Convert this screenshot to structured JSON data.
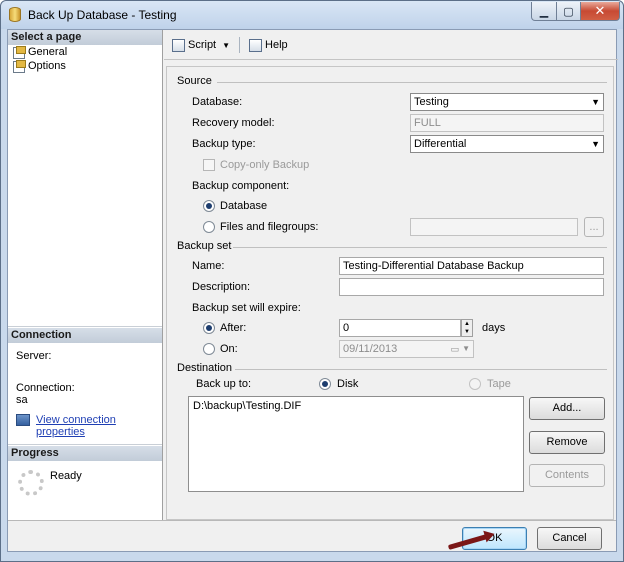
{
  "window": {
    "title": "Back Up Database - Testing",
    "controls": {
      "minimize": "▁",
      "maximize": "▢",
      "close": "✕"
    }
  },
  "sidebar": {
    "select_page_header": "Select a page",
    "pages": [
      {
        "label": "General",
        "icon": "page-icon"
      },
      {
        "label": "Options",
        "icon": "page-icon"
      }
    ],
    "connection_header": "Connection",
    "server_label": "Server:",
    "server_value": "",
    "connection_label": "Connection:",
    "connection_value": "sa",
    "view_props_link": "View connection properties",
    "progress_header": "Progress",
    "progress_status": "Ready"
  },
  "toolbar": {
    "script_label": "Script",
    "help_label": "Help"
  },
  "source": {
    "header": "Source",
    "database_label": "Database:",
    "database_value": "Testing",
    "recovery_label": "Recovery model:",
    "recovery_value": "FULL",
    "backup_type_label": "Backup type:",
    "backup_type_value": "Differential",
    "copy_only_label": "Copy-only Backup",
    "component_label": "Backup component:",
    "component_database": "Database",
    "component_files": "Files and filegroups:",
    "browse_label": "..."
  },
  "backup_set": {
    "header": "Backup set",
    "name_label": "Name:",
    "name_value": "Testing-Differential Database Backup",
    "description_label": "Description:",
    "description_value": "",
    "expire_label": "Backup set will expire:",
    "after_label": "After:",
    "after_value": "0",
    "days_label": "days",
    "on_label": "On:",
    "on_value": "09/11/2013"
  },
  "destination": {
    "header": "Destination",
    "backup_to_label": "Back up to:",
    "disk_label": "Disk",
    "tape_label": "Tape",
    "files": [
      "D:\\backup\\Testing.DIF"
    ],
    "add_label": "Add...",
    "remove_label": "Remove",
    "contents_label": "Contents"
  },
  "footer": {
    "ok_label": "OK",
    "cancel_label": "Cancel"
  },
  "colors": {
    "link": "#1f3fb4",
    "annotation_arrow": "#7b1717"
  }
}
